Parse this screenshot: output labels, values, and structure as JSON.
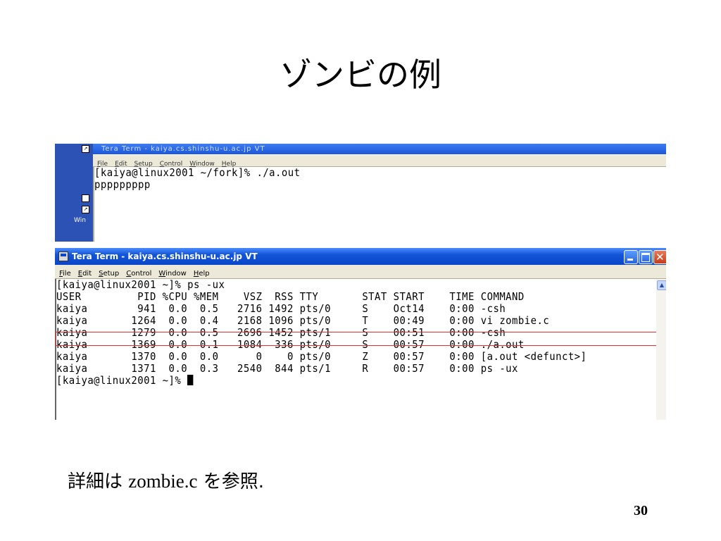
{
  "slide": {
    "title": "ゾンビの例",
    "caption_pre": "詳細は ",
    "caption_code": "zombie.c",
    "caption_post": " を参照.",
    "page_number": "30"
  },
  "desktop": {
    "icon_label": "Win"
  },
  "back_window": {
    "title": "Tera Term - kaiya.cs.shinshu-u.ac.jp VT",
    "menu": [
      "File",
      "Edit",
      "Setup",
      "Control",
      "Window",
      "Help"
    ],
    "lines": [
      "[kaiya@linux2001 ~/fork]% ./a.out",
      "ppppppppp"
    ]
  },
  "front_window": {
    "title": "Tera Term - kaiya.cs.shinshu-u.ac.jp VT",
    "menu": [
      "File",
      "Edit",
      "Setup",
      "Control",
      "Window",
      "Help"
    ],
    "lines": [
      "[kaiya@linux2001 ~]% ps -ux",
      "USER         PID %CPU %MEM    VSZ  RSS TTY       STAT START    TIME COMMAND",
      "kaiya        941  0.0  0.5   2716 1492 pts/0     S    Oct14    0:00 -csh",
      "kaiya       1264  0.0  0.4   2168 1096 pts/0     T    00:49    0:00 vi zombie.c",
      "kaiya       1279  0.0  0.5   2696 1452 pts/1     S    00:51    0:00 -csh",
      "kaiya       1369  0.0  0.1   1084  336 pts/0     S    00:57    0:00 ./a.out",
      "kaiya       1370  0.0  0.0      0    0 pts/0     Z    00:57    0:00 [a.out <defunct>]",
      "kaiya       1371  0.0  0.3   2540  844 pts/1     R    00:57    0:00 ps -ux",
      "[kaiya@linux2001 ~]% "
    ],
    "highlight_color": "#e53030"
  }
}
